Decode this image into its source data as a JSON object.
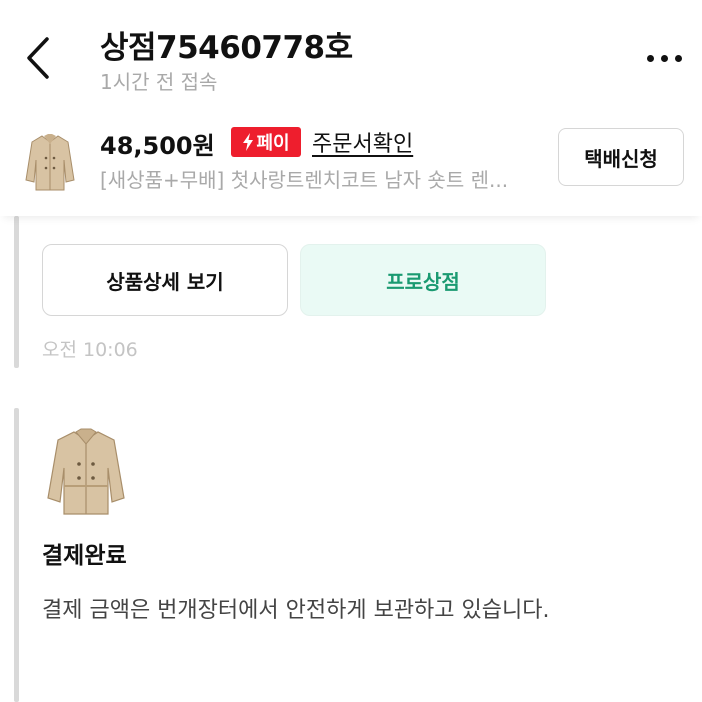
{
  "header": {
    "title": "상점75460778호",
    "subtitle": "1시간 전 접속"
  },
  "order": {
    "price": "48,500원",
    "pay_badge": "페이",
    "order_confirm": "주문서확인",
    "product_name": "[새상품+무배] 첫사랑트렌치코트 남자 숏트 렌...",
    "ship_button": "택배신청"
  },
  "chat": {
    "detail_button": "상품상세 보기",
    "pro_button": "프로상점",
    "time": "오전 10:06",
    "paid_title": "결제완료",
    "paid_desc": "결제 금액은 번개장터에서 안전하게 보관하고 있습니다."
  },
  "colors": {
    "pay_red": "#ee1e2d",
    "pro_green": "#1a9a71",
    "pro_bg": "#eafaf5"
  },
  "icons": {
    "back": "chevron-left-icon",
    "more": "more-horizontal-icon",
    "pay": "lightning-icon"
  }
}
